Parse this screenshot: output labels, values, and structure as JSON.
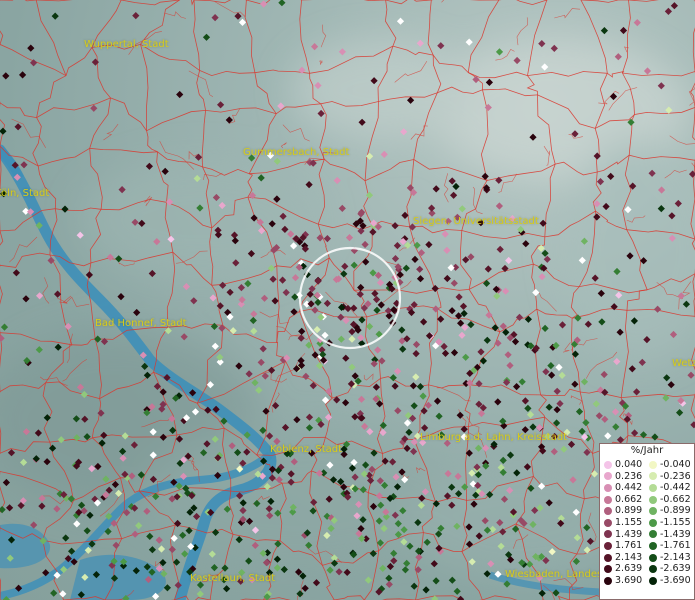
{
  "map": {
    "cities": [
      {
        "name": "Wuppertal, Stadt"
      },
      {
        "name": "Gummersbach, Stadt"
      },
      {
        "name": "Köln, Stadt"
      },
      {
        "name": "Siegen, Universitätsstadt"
      },
      {
        "name": "Bad Honnef, Stadt"
      },
      {
        "name": "Koblenz, Stadt"
      },
      {
        "name": "Limburg a.d. Lahn, Kreisstadt"
      },
      {
        "name": "Wetzlar"
      },
      {
        "name": "Kastellaun, Stadt"
      },
      {
        "name": "Wiesbaden, Landes"
      }
    ],
    "colors": {
      "background": "#8fa9a6",
      "river": "#3e8fb8",
      "boundary": "#d9372e",
      "label": "#d8cc1a"
    }
  },
  "legend": {
    "title": "%/Jahr",
    "positive": [
      {
        "label": "0.040",
        "color": "#f4c4e8"
      },
      {
        "label": "0.236",
        "color": "#e8a7cd"
      },
      {
        "label": "0.442",
        "color": "#d88fb4"
      },
      {
        "label": "0.662",
        "color": "#c77898"
      },
      {
        "label": "0.899",
        "color": "#b05f7e"
      },
      {
        "label": "1.155",
        "color": "#984a66"
      },
      {
        "label": "1.439",
        "color": "#7f3350"
      },
      {
        "label": "1.761",
        "color": "#6a2139"
      },
      {
        "label": "2.143",
        "color": "#551428"
      },
      {
        "label": "2.639",
        "color": "#420a1a"
      },
      {
        "label": "3.690",
        "color": "#2a030d"
      }
    ],
    "negative": [
      {
        "label": "-0.040",
        "color": "#f2f7c4"
      },
      {
        "label": "-0.236",
        "color": "#d6ecb0"
      },
      {
        "label": "-0.442",
        "color": "#b4dc96"
      },
      {
        "label": "-0.662",
        "color": "#91c97c"
      },
      {
        "label": "-0.899",
        "color": "#6fb362"
      },
      {
        "label": "-1.155",
        "color": "#4d9a48"
      },
      {
        "label": "-1.439",
        "color": "#347e34"
      },
      {
        "label": "-1.761",
        "color": "#216424"
      },
      {
        "label": "-2.143",
        "color": "#144d18"
      },
      {
        "label": "-2.639",
        "color": "#0b3710"
      },
      {
        "label": "-3.690",
        "color": "#042308"
      }
    ]
  }
}
